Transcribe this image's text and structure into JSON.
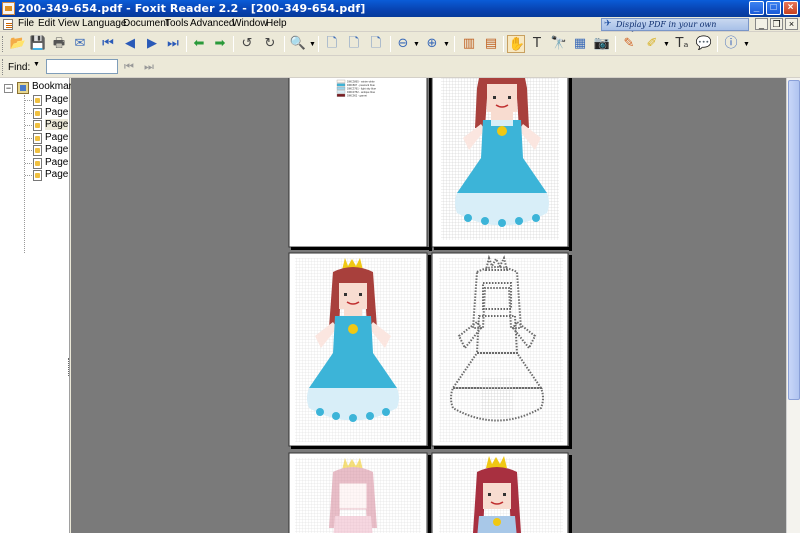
{
  "window": {
    "title": "200-349-654.pdf - Foxit Reader 2.2 - [200-349-654.pdf]",
    "min_label": "_",
    "max_label": "□",
    "close_label": "×"
  },
  "menu": {
    "items": [
      "File",
      "Edit",
      "View",
      "Language",
      "Document",
      "Tools",
      "Advanced",
      "Window",
      "Help"
    ],
    "promo": "Display PDF in your own applications"
  },
  "find": {
    "label": "Find:",
    "value": ""
  },
  "bookmarks": {
    "root_label": "Bookmark",
    "pages": [
      "Page",
      "Page",
      "Page",
      "Page",
      "Page",
      "Page",
      "Page"
    ],
    "selected_index": 2
  },
  "legend_lines": [
    "DMC3865 - winter white",
    "DMC807 - peacock blue",
    "DMC3761 - light sky blue",
    "DMC3752 - antique blue",
    "DMC902 - garnet"
  ],
  "colors": {
    "hair": "#a8403c",
    "dress_blue": "#3cb4d8",
    "dress_light": "#d8eef8",
    "skin": "#f8d8c8",
    "crown": "#f0c814",
    "grey": "#6a6a6a",
    "pink": "#d88a9c"
  }
}
